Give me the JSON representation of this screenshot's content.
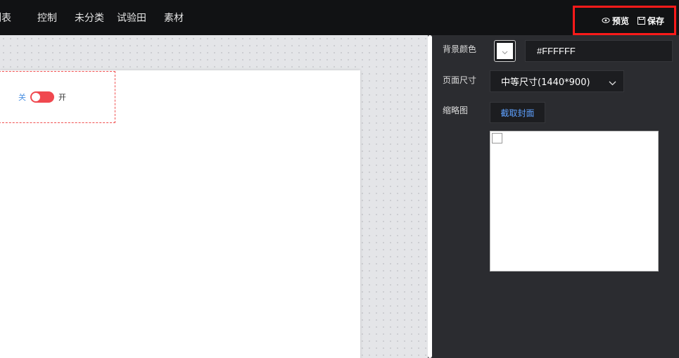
{
  "nav": {
    "items": [
      {
        "label": "列表"
      },
      {
        "label": "控制"
      },
      {
        "label": "未分类"
      },
      {
        "label": "试验田"
      },
      {
        "label": "素材"
      }
    ]
  },
  "actions": {
    "preview_label": "预览",
    "save_label": "保存",
    "preview_icon": "eye-icon",
    "save_icon": "save-icon"
  },
  "canvas": {
    "switch": {
      "off_label": "关",
      "on_label": "开",
      "color": "#f0484f"
    }
  },
  "panel": {
    "bg_color_label": "背景颜色",
    "bg_color_value": "#FFFFFF",
    "page_size_label": "页面尺寸",
    "page_size_value": "中等尺寸(1440*900)",
    "thumbnail_label": "缩略图",
    "capture_label": "截取封面"
  },
  "colors": {
    "accent": "#5ea1ff",
    "highlight": "#ff1a1a",
    "topbar": "#111214",
    "panel": "#2b2c30"
  }
}
